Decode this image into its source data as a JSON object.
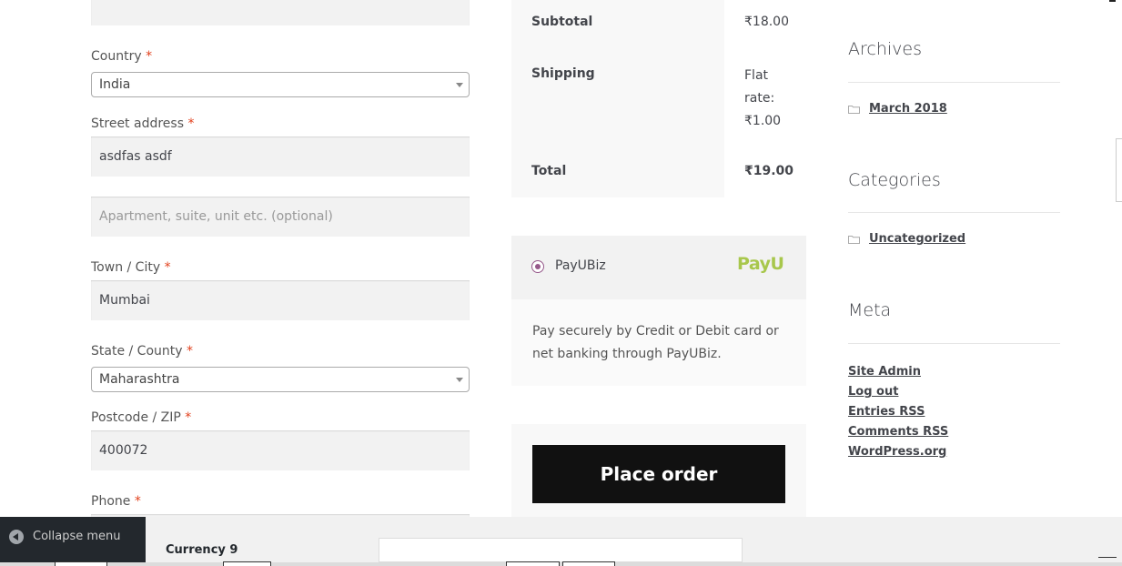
{
  "form": {
    "country": {
      "label": "Country",
      "required_mark": "*",
      "value": "India"
    },
    "street": {
      "label": "Street address",
      "required_mark": "*",
      "value": "asdfas asdf",
      "placeholder2": "Apartment, suite, unit etc. (optional)"
    },
    "city": {
      "label": "Town / City",
      "required_mark": "*",
      "value": "Mumbai"
    },
    "state": {
      "label": "State / County",
      "required_mark": "*",
      "value": "Maharashtra"
    },
    "postcode": {
      "label": "Postcode / ZIP",
      "required_mark": "*",
      "value": "400072"
    },
    "phone": {
      "label": "Phone",
      "required_mark": "*"
    }
  },
  "order": {
    "subtotal_label": "Subtotal",
    "subtotal_value": "₹18.00",
    "shipping_label": "Shipping",
    "shipping_value": "Flat rate: ₹1.00",
    "total_label": "Total",
    "total_value": "₹19.00"
  },
  "payment": {
    "method_label": "PayUBiz",
    "logo_text": "PayU",
    "description": "Pay securely by Credit or Debit card or net banking through PayUBiz.",
    "place_order": "Place order",
    "accent": "#96588a"
  },
  "sidebar": {
    "archives_title": "Archives",
    "archives_items": [
      "March 2018"
    ],
    "categories_title": "Categories",
    "categories_items": [
      "Uncategorized"
    ],
    "meta_title": "Meta",
    "meta_items": [
      "Site Admin",
      "Log out",
      "Entries RSS",
      "Comments RSS",
      "WordPress.org"
    ]
  },
  "admin": {
    "collapse_label": "Collapse menu",
    "currency_label": "Currency 9"
  }
}
